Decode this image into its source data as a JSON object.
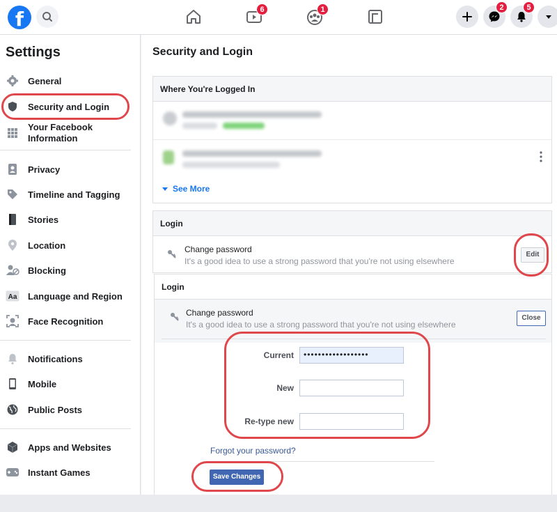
{
  "topbar": {
    "logo_text": "f",
    "video_badge": "6",
    "groups_badge": "1",
    "messenger_badge": "2",
    "notifications_badge": "5",
    "icons": [
      "search-icon",
      "home-icon",
      "video-icon",
      "groups-icon",
      "gaming-icon",
      "plus-icon",
      "messenger-icon",
      "bell-icon",
      "caret-down-icon"
    ]
  },
  "sidebar": {
    "title": "Settings",
    "items": [
      {
        "label": "General",
        "icon": "gear-icon"
      },
      {
        "label": "Security and Login",
        "icon": "shield-icon"
      },
      {
        "label": "Your Facebook Information",
        "icon": "grid-icon"
      },
      {
        "label": "Privacy",
        "icon": "lock-person-icon"
      },
      {
        "label": "Timeline and Tagging",
        "icon": "tag-icon"
      },
      {
        "label": "Stories",
        "icon": "book-icon"
      },
      {
        "label": "Location",
        "icon": "pin-icon"
      },
      {
        "label": "Blocking",
        "icon": "block-user-icon"
      },
      {
        "label": "Language and Region",
        "icon": "language-icon"
      },
      {
        "label": "Face Recognition",
        "icon": "face-scan-icon"
      },
      {
        "label": "Notifications",
        "icon": "bell-icon"
      },
      {
        "label": "Mobile",
        "icon": "phone-icon"
      },
      {
        "label": "Public Posts",
        "icon": "globe-icon"
      },
      {
        "label": "Apps and Websites",
        "icon": "cube-icon"
      },
      {
        "label": "Instant Games",
        "icon": "gamepad-icon"
      }
    ]
  },
  "main": {
    "title": "Security and Login",
    "logged_in": {
      "header": "Where You're Logged In",
      "see_more": "See More"
    },
    "login_collapsed": {
      "header": "Login",
      "row_title": "Change password",
      "row_desc": "It's a good idea to use a strong password that you're not using elsewhere",
      "edit_label": "Edit"
    },
    "login_expanded": {
      "header": "Login",
      "row_title": "Change password",
      "row_desc": "It's a good idea to use a strong password that you're not using elsewhere",
      "close_label": "Close",
      "current_label": "Current",
      "current_value": "••••••••••••••••••",
      "new_label": "New",
      "new_value": "",
      "retype_label": "Re-type new",
      "retype_value": "",
      "forgot_link": "Forgot your password?",
      "save_label": "Save Changes"
    }
  },
  "colors": {
    "brand": "#1877f2",
    "highlight": "#e0474c",
    "save_button": "#4267b2",
    "badge": "#e41e3f"
  }
}
